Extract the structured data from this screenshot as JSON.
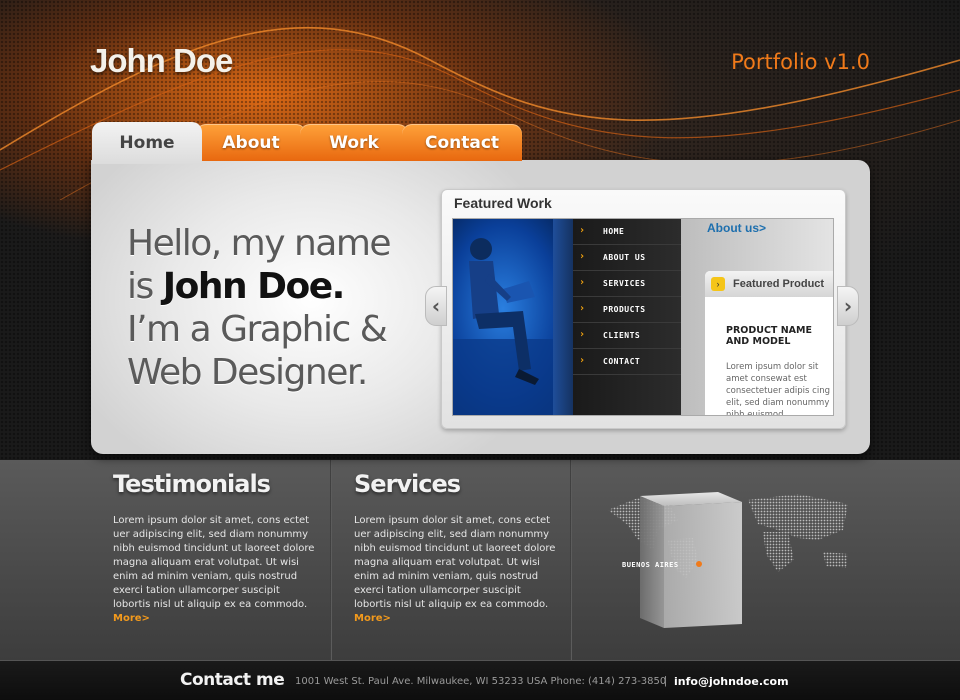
{
  "header": {
    "logo": "John Doe",
    "tagline": "Portfolio v1.0"
  },
  "nav": {
    "tabs": [
      {
        "label": "Home",
        "active": true
      },
      {
        "label": "About",
        "active": false
      },
      {
        "label": "Work",
        "active": false
      },
      {
        "label": "Contact",
        "active": false
      }
    ]
  },
  "hero": {
    "line1": "Hello, my name",
    "line2_prefix": "is ",
    "line2_name": "John Doe.",
    "line3": "I’m a Graphic &",
    "line4": "Web Designer."
  },
  "featured": {
    "title": "Featured Work",
    "menu": [
      "HOME",
      "ABOUT US",
      "SERVICES",
      "PRODUCTS",
      "CLIENTS",
      "CONTACT"
    ],
    "about_link": "About us>",
    "product_heading": "Featured Product",
    "product_name": "PRODUCT NAME AND MODEL",
    "product_desc": "Lorem ipsum dolor sit amet consewat est consectetuer adipis cing elit, sed diam nonummy nibh euismod"
  },
  "testimonials": {
    "heading": "Testimonials",
    "body": "Lorem ipsum dolor sit amet, cons ectet uer adipiscing elit, sed diam nonummy nibh euismod tincidunt ut laoreet dolore magna aliquam erat volutpat. Ut wisi enim ad minim veniam, quis nostrud exerci tation ullamcorper suscipit lobortis nisl ut aliquip ex ea commodo.",
    "more": "More>"
  },
  "services": {
    "heading": "Services",
    "body": "Lorem ipsum dolor sit amet, cons ectet uer adipiscing elit, sed diam nonummy nibh euismod tincidunt ut laoreet dolore magna aliquam erat volutpat. Ut wisi enim ad minim veniam, quis nostrud exerci tation ullamcorper suscipit lobortis nisl ut aliquip ex ea commodo.",
    "more": "More>"
  },
  "map": {
    "city": "BUENOS AIRES"
  },
  "footer": {
    "title": "Contact me",
    "address": "1001 West St. Paul Ave. Milwaukee, WI  53233  USA Phone: (414) 273-3850",
    "pipe": "|",
    "email": "info@johndoe.com"
  },
  "colors": {
    "accent": "#f07a1a",
    "tab_orange": "#e8680f",
    "link_blue": "#1d6fae"
  },
  "icons": [
    "chevron-left-icon",
    "chevron-right-icon",
    "arrow-right-icon",
    "cube-icon",
    "world-map-icon"
  ]
}
